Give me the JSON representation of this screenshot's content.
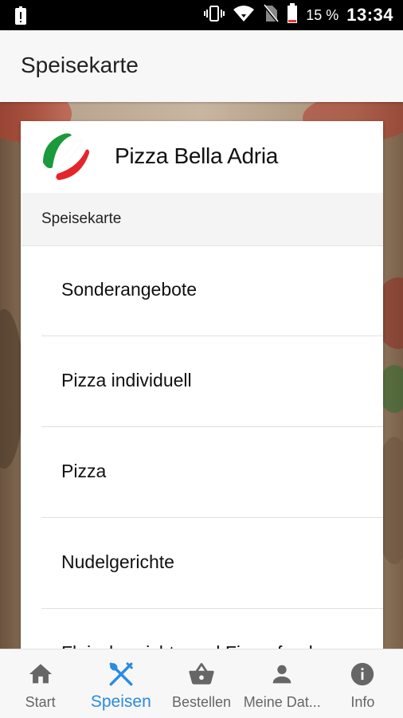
{
  "status_bar": {
    "battery_percent": "15 %",
    "time": "13:34"
  },
  "app_bar": {
    "title": "Speisekarte"
  },
  "restaurant": {
    "name": "Pizza Bella Adria"
  },
  "section": {
    "label": "Speisekarte"
  },
  "menu": {
    "items": [
      {
        "label": "Sonderangebote"
      },
      {
        "label": "Pizza individuell"
      },
      {
        "label": "Pizza"
      },
      {
        "label": "Nudelgerichte"
      },
      {
        "label": "Fleischgerichte und Fingerfood"
      }
    ]
  },
  "bottom_nav": {
    "items": [
      {
        "label": "Start",
        "icon": "home-icon",
        "active": false
      },
      {
        "label": "Speisen",
        "icon": "cutlery-icon",
        "active": true
      },
      {
        "label": "Bestellen",
        "icon": "basket-icon",
        "active": false
      },
      {
        "label": "Meine Dat...",
        "icon": "person-icon",
        "active": false
      },
      {
        "label": "Info",
        "icon": "info-icon",
        "active": false
      }
    ],
    "active_color": "#2a8be0",
    "inactive_color": "#666666"
  },
  "colors": {
    "logo_green": "#1a9a3a",
    "logo_red": "#e3262b"
  }
}
